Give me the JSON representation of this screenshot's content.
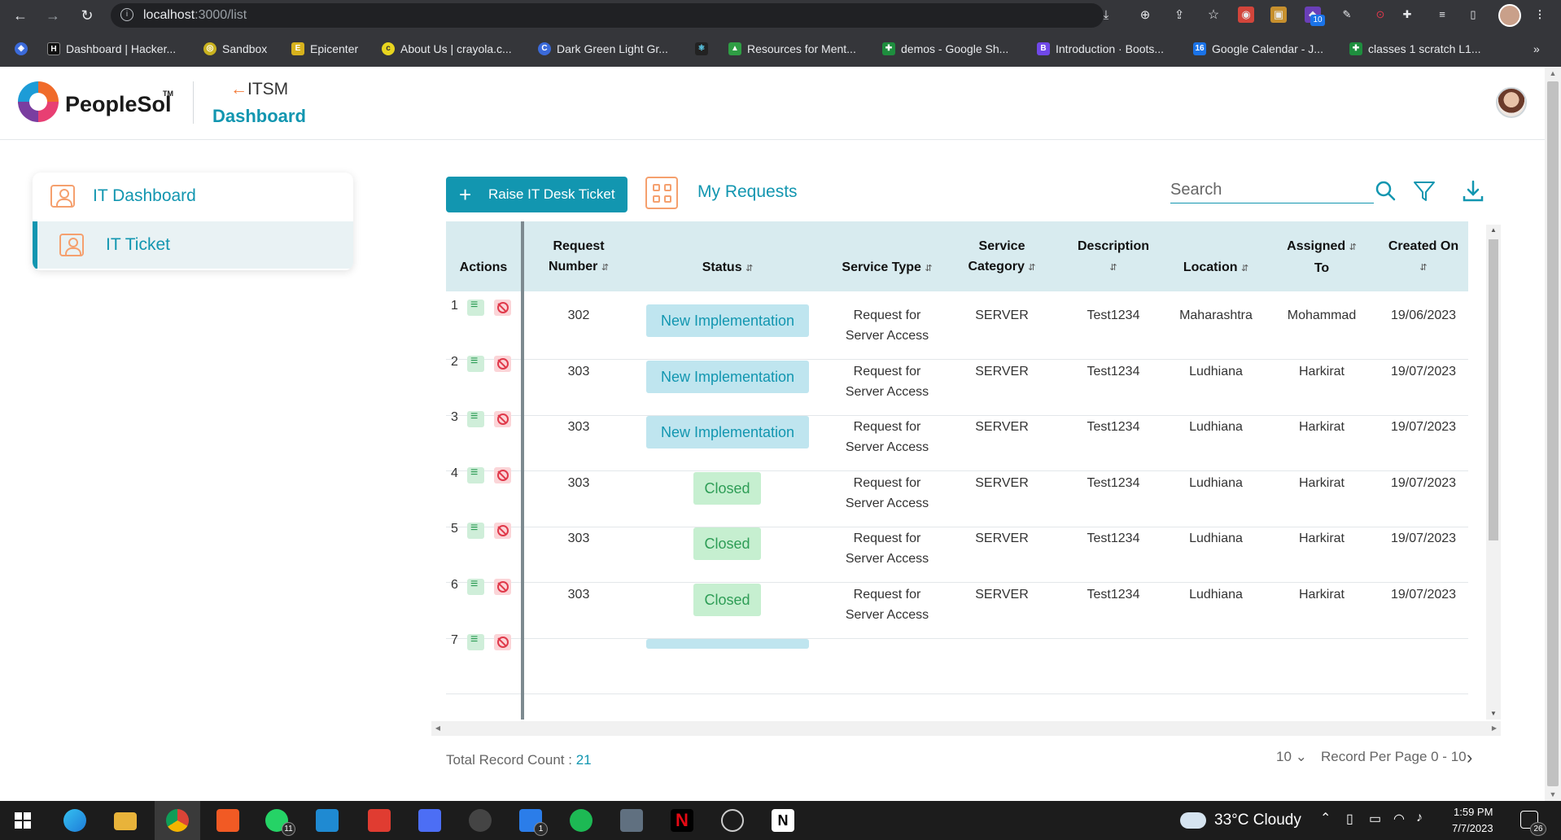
{
  "browser": {
    "url_host": "localhost",
    "url_rest": ":3000/list",
    "bookmarks": [
      {
        "label": "Dashboard | Hacker..."
      },
      {
        "label": "Sandbox"
      },
      {
        "label": "Epicenter"
      },
      {
        "label": "About Us | crayola.c..."
      },
      {
        "label": "Dark Green Light Gr..."
      },
      {
        "label": ""
      },
      {
        "label": "Resources for Ment..."
      },
      {
        "label": "demos - Google Sh..."
      },
      {
        "label": "Introduction · Boots..."
      },
      {
        "label": "Google Calendar - J..."
      },
      {
        "label": "classes 1 scratch L1..."
      }
    ],
    "ext_badge": "10",
    "more": "»"
  },
  "header": {
    "brand": "PeopleSol",
    "tm": "TM",
    "back_arrow": "←",
    "back_label": "ITSM",
    "title": "Dashboard"
  },
  "sidebar": {
    "items": [
      {
        "label": "IT Dashboard"
      },
      {
        "label": "IT Ticket"
      }
    ]
  },
  "toolbar": {
    "raise_plus": "+",
    "raise_label": "Raise IT Desk Ticket",
    "my_requests": "My Requests",
    "search_placeholder": "Search"
  },
  "table": {
    "headers": {
      "actions": "Actions",
      "request_number_1": "Request",
      "request_number_2": "Number",
      "status": "Status",
      "service_type": "Service Type",
      "service_category_1": "Service",
      "service_category_2": "Category",
      "description": "Description",
      "location": "Location",
      "assigned_1": "Assigned",
      "assigned_2": "To",
      "created_on": "Created On",
      "sort_glyph": "⇵"
    },
    "rows": [
      {
        "n": "1",
        "req": "302",
        "status": "New Implementation",
        "stype1": "Request for",
        "stype2": "Server Access",
        "cat": "SERVER",
        "desc": "Test1234",
        "loc": "Maharashtra",
        "assigned": "Mohammad",
        "created": "19/06/2023"
      },
      {
        "n": "2",
        "req": "303",
        "status": "New Implementation",
        "stype1": "Request for",
        "stype2": "Server Access",
        "cat": "SERVER",
        "desc": "Test1234",
        "loc": "Ludhiana",
        "assigned": "Harkirat",
        "created": "19/07/2023"
      },
      {
        "n": "3",
        "req": "303",
        "status": "New Implementation",
        "stype1": "Request for",
        "stype2": "Server Access",
        "cat": "SERVER",
        "desc": "Test1234",
        "loc": "Ludhiana",
        "assigned": "Harkirat",
        "created": "19/07/2023"
      },
      {
        "n": "4",
        "req": "303",
        "status": "Closed",
        "stype1": "Request for",
        "stype2": "Server Access",
        "cat": "SERVER",
        "desc": "Test1234",
        "loc": "Ludhiana",
        "assigned": "Harkirat",
        "created": "19/07/2023"
      },
      {
        "n": "5",
        "req": "303",
        "status": "Closed",
        "stype1": "Request for",
        "stype2": "Server Access",
        "cat": "SERVER",
        "desc": "Test1234",
        "loc": "Ludhiana",
        "assigned": "Harkirat",
        "created": "19/07/2023"
      },
      {
        "n": "6",
        "req": "303",
        "status": "Closed",
        "stype1": "Request for",
        "stype2": "Server Access",
        "cat": "SERVER",
        "desc": "Test1234",
        "loc": "Ludhiana",
        "assigned": "Harkirat",
        "created": "19/07/2023"
      },
      {
        "n": "7",
        "req": "",
        "status": "",
        "stype1": "",
        "stype2": "",
        "cat": "",
        "desc": "",
        "loc": "",
        "assigned": "",
        "created": ""
      }
    ]
  },
  "footer": {
    "total_label": "Total Record Count : ",
    "total_value": "21",
    "per_page_value": "10",
    "per_page_chevron": "⌄",
    "per_page_label": "Record Per Page 0 - 10",
    "next": "›"
  },
  "taskbar": {
    "whatsapp_badge": "11",
    "todo_badge": "1",
    "weather": "33°C  Cloudy",
    "time": "1:59 PM",
    "date": "7/7/2023",
    "notif_count": "26"
  },
  "colors": {
    "brand": "#1296b0",
    "accent_orange": "#f5a06e",
    "table_header_bg": "#d8ebef",
    "impl_bg": "#bfe5ef",
    "closed_bg": "#c6efd0"
  }
}
